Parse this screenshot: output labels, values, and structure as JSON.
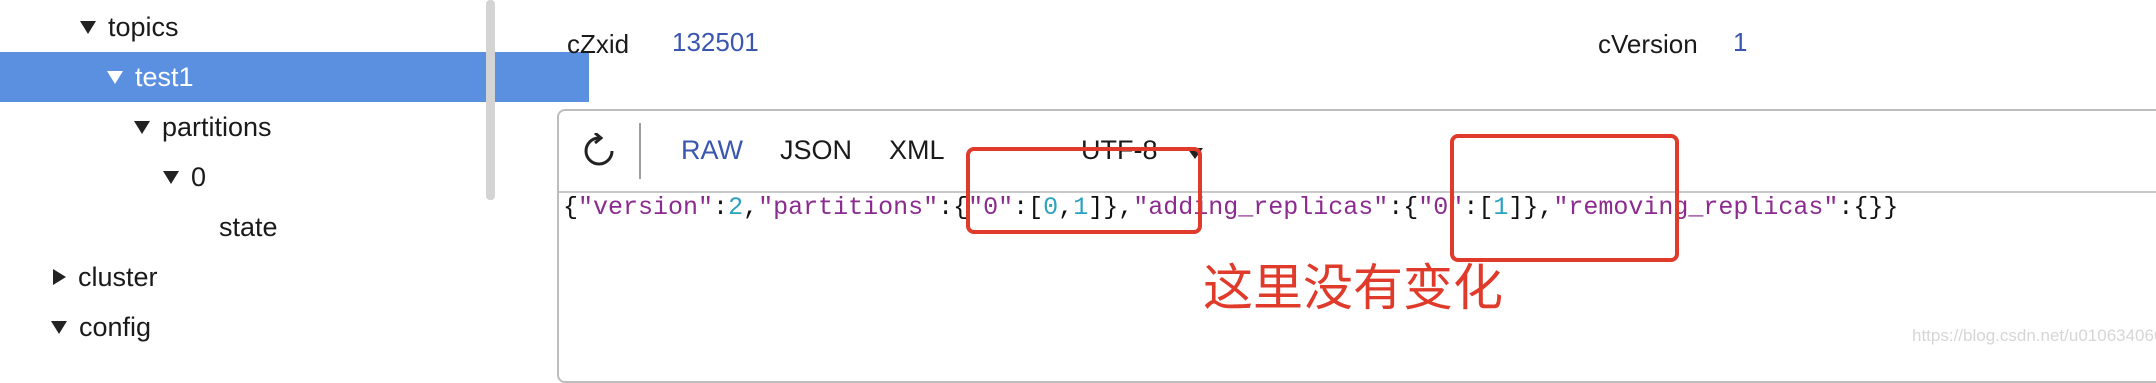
{
  "tree": {
    "items": [
      {
        "label": "topics",
        "expanded": true,
        "selected": false
      },
      {
        "label": "test1",
        "expanded": true,
        "selected": true
      },
      {
        "label": "partitions",
        "expanded": true,
        "selected": false
      },
      {
        "label": "0",
        "expanded": true,
        "selected": false
      },
      {
        "label": "state",
        "expanded": null,
        "selected": false
      },
      {
        "label": "cluster",
        "expanded": false,
        "selected": false
      },
      {
        "label": "config",
        "expanded": true,
        "selected": false
      }
    ]
  },
  "meta": {
    "czxid_label": "cZxid",
    "czxid_value": "132501",
    "cversion_label": "cVersion",
    "cversion_value": "1"
  },
  "viewer": {
    "formats": [
      "RAW",
      "JSON",
      "XML"
    ],
    "active_format": "RAW",
    "encoding": "UTF-8",
    "content_tokens": [
      {
        "text": "{",
        "kind": "punct"
      },
      {
        "text": "\"version\"",
        "kind": "key"
      },
      {
        "text": ":",
        "kind": "punct"
      },
      {
        "text": "2",
        "kind": "num"
      },
      {
        "text": ",",
        "kind": "punct"
      },
      {
        "text": "\"partitions\"",
        "kind": "key"
      },
      {
        "text": ":{",
        "kind": "punct"
      },
      {
        "text": "\"0\"",
        "kind": "key"
      },
      {
        "text": ":[",
        "kind": "punct"
      },
      {
        "text": "0",
        "kind": "num"
      },
      {
        "text": ",",
        "kind": "punct"
      },
      {
        "text": "1",
        "kind": "num"
      },
      {
        "text": "]},",
        "kind": "punct"
      },
      {
        "text": "\"adding_replicas\"",
        "kind": "key"
      },
      {
        "text": ":{",
        "kind": "punct"
      },
      {
        "text": "\"0\"",
        "kind": "key"
      },
      {
        "text": ":[",
        "kind": "punct"
      },
      {
        "text": "1",
        "kind": "num"
      },
      {
        "text": "]},",
        "kind": "punct"
      },
      {
        "text": "\"removing_replicas\"",
        "kind": "key"
      },
      {
        "text": ":{}}",
        "kind": "punct"
      }
    ]
  },
  "annotation": {
    "text": "这里没有变化",
    "color": "#e03a2a"
  },
  "watermark": "https://blog.csdn.net/u010634066",
  "colors": {
    "selected_bg": "#5b8fe0",
    "accent": "#3a56b0",
    "json_key": "#8b2a8f",
    "json_number": "#2aa2c2"
  }
}
